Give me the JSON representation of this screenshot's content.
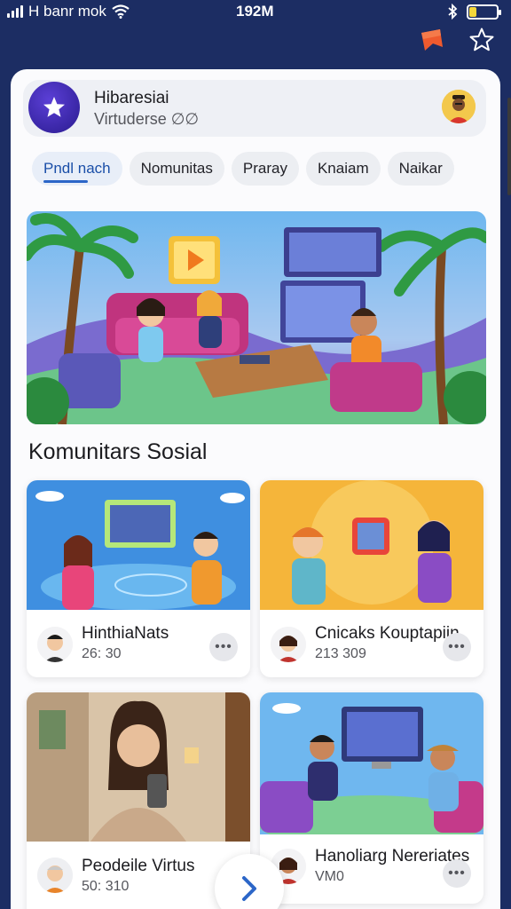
{
  "status_bar": {
    "carrier": "H banr mok",
    "center_text": "192M",
    "battery_level": 0.25,
    "icons": [
      "signal-icon",
      "wifi-icon",
      "bluetooth-icon",
      "battery-icon"
    ]
  },
  "header_actions": [
    "bookmark-icon",
    "star-icon"
  ],
  "profile": {
    "name": "Hibaresiai",
    "subtitle": "Virtuderse ∅∅"
  },
  "tabs": [
    {
      "label": "Pndl nach",
      "active": true
    },
    {
      "label": "Nomunitas",
      "active": false
    },
    {
      "label": "Praray",
      "active": false
    },
    {
      "label": "Knaiam",
      "active": false
    },
    {
      "label": "Naikar",
      "active": false
    }
  ],
  "section_title": "Komunitars Sosial",
  "cards": [
    {
      "title": "HinthiaNats",
      "count": "26: 30"
    },
    {
      "title": "Cnicaks Kouptapiin",
      "count": "213 309"
    },
    {
      "title": "Peodeile Virtus",
      "count": "50: 310"
    },
    {
      "title": "Hanoliarg Nereriates",
      "count": "VM0"
    }
  ],
  "more_label": "•••",
  "colors": {
    "header_bg": "#1c2d63",
    "accent": "#2c66c8",
    "logo": "#3b27b4",
    "card_orange": "#f5b53a"
  }
}
